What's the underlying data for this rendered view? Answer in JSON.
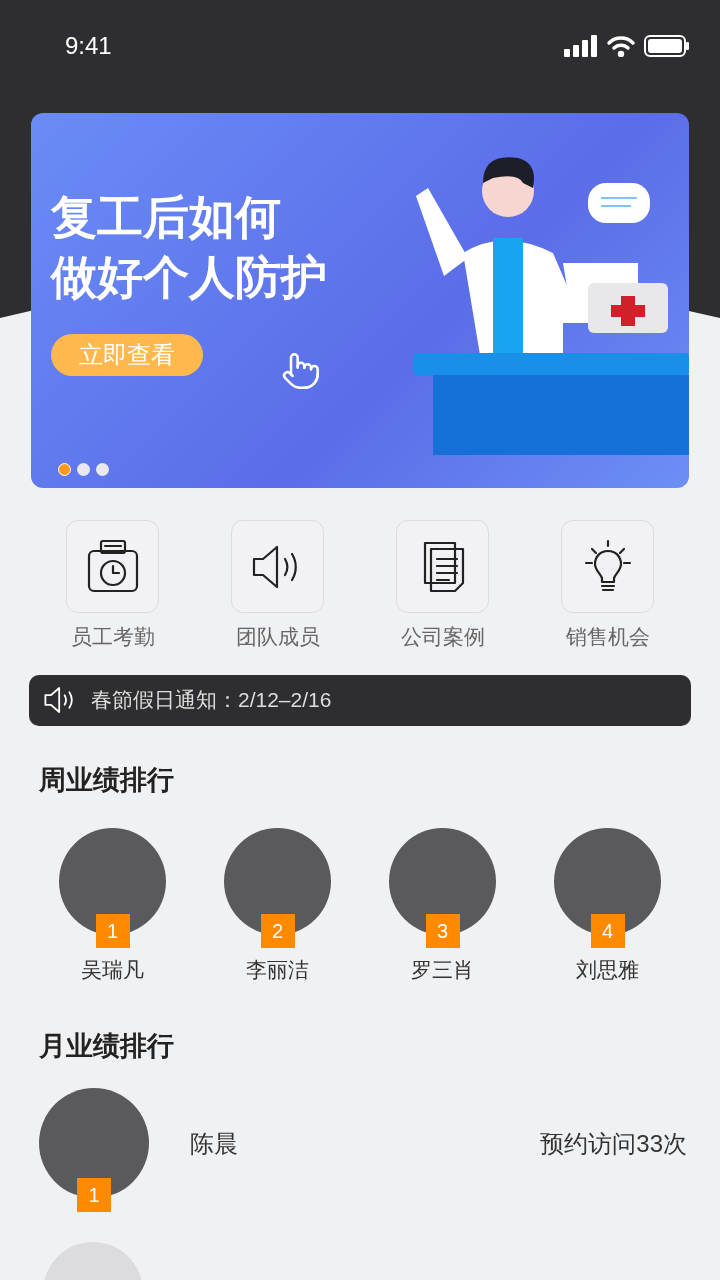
{
  "status_bar": {
    "time": "9:41"
  },
  "banner": {
    "title_lines": [
      "复工后如何",
      "做好个人防护"
    ],
    "button": "立即查看",
    "dots": [
      {
        "selected": true
      },
      {
        "selected": false
      },
      {
        "selected": false
      }
    ]
  },
  "shortcuts": [
    {
      "kind": "attendance",
      "label": "员工考勤"
    },
    {
      "kind": "speaker",
      "label": "团队成员"
    },
    {
      "kind": "documents",
      "label": "公司案例"
    },
    {
      "kind": "bulb",
      "label": "销售机会"
    }
  ],
  "notice": {
    "text": "春節假日通知：2/12–2/16"
  },
  "weekly": {
    "title": "周业绩排行",
    "people": [
      {
        "rank": "1",
        "name": "吴瑞凡"
      },
      {
        "rank": "2",
        "name": "李丽洁"
      },
      {
        "rank": "3",
        "name": "罗三肖"
      },
      {
        "rank": "4",
        "name": "刘思雅"
      }
    ]
  },
  "monthly": {
    "title": "月业绩排行",
    "rows": [
      {
        "rank": "1",
        "name": "陈晨",
        "stat": "预约访问33次"
      }
    ]
  }
}
